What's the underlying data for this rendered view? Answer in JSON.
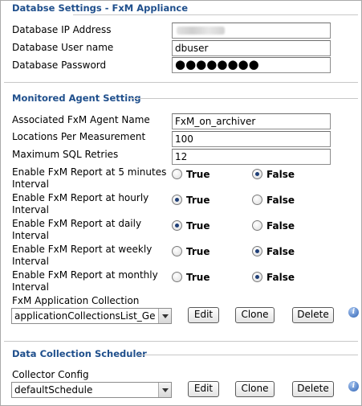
{
  "sections": {
    "db": {
      "title": "Databse Settings - FxM Appliance"
    },
    "agent": {
      "title": "Monitored Agent Setting"
    },
    "scheduler": {
      "title": "Data Collection Scheduler"
    }
  },
  "db": {
    "ip_label": "Database IP Address",
    "user_label": "Database User name",
    "user_value": "dbuser",
    "pw_label": "Database Password",
    "pw_value": "●●●●●●●●"
  },
  "agent": {
    "name_label": "Associated FxM Agent Name",
    "name_value": "FxM_on_archiver",
    "locations_label": "Locations Per Measurement",
    "locations_value": "100",
    "retries_label": "Maximum SQL Retries",
    "retries_value": "12",
    "reports": [
      {
        "label": "Enable FxM Report at 5 minutes\nInterval",
        "selected": "False"
      },
      {
        "label": "Enable FxM Report at hourly\nInterval",
        "selected": "True"
      },
      {
        "label": "Enable FxM Report at daily\nInterval",
        "selected": "True"
      },
      {
        "label": "Enable FxM Report at weekly\nInterval",
        "selected": "False"
      },
      {
        "label": "Enable FxM Report at monthly\nInterval",
        "selected": "False"
      }
    ],
    "true_label": "True",
    "false_label": "False",
    "collection_label": "FxM Application Collection",
    "collection_value": "applicationCollectionsList_Geo@l"
  },
  "scheduler": {
    "collector_label": "Collector Config",
    "collector_value": "defaultSchedule"
  },
  "buttons": {
    "edit": "Edit",
    "clone": "Clone",
    "delete": "Delete"
  },
  "info_glyph": "i",
  "colors": {
    "section_title": "#1f4f8c",
    "radio_dot": "#1f3f77",
    "info_icon": "#2f63b5"
  }
}
